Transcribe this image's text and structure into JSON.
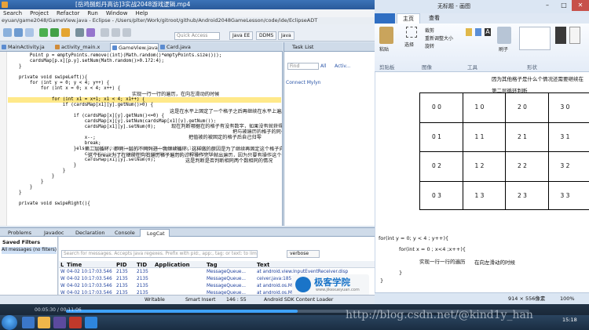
{
  "eclipse": {
    "window_title": "[岳鸡捌彪丹高访]3实战2048游戏逻辑.mp4",
    "path_title": "eyuan/game2048/GameView.java - Eclipse - /Users/plter/Work/gitroot/github/Android2048GameLesson/code/ide/EclipseADT",
    "menu": [
      "Search",
      "Project",
      "Refactor",
      "Run",
      "Window",
      "Help"
    ],
    "quick_access": "Quick Access",
    "perspectives": [
      "Java EE",
      "DDMS",
      "Java"
    ],
    "editor_tabs": [
      "MainActivity.ja",
      "activity_main.x",
      "GameView.java",
      "Card.java"
    ],
    "code_lines": [
      "        Point p = emptyPoints.remove((int)(Math.random()*emptyPoints.size()));",
      "        cardsMap[p.x][p.y].setNum(Math.random()>0.1?2:4);",
      "    }",
      "",
      "    private void swipeLeft(){",
      "        for (int y = 0; y < 4; y++) {",
      "            for (int x = 0; x < 4; x++) {",
      "",
      "                for (int x1 = x+1; x1 < 4; x1++) {",
      "                    if (cardsMap[x1][y].getNum()>0) {",
      "",
      "                        if (cardsMap[x][y].getNum()<=0) {",
      "                            cardsMap[x][y].setNum(cardsMap[x1][y].getNum());",
      "                            cardsMap[x1][y].setNum(0);",
      "",
      "                            x--;",
      "                            break;",
      "                        }else if (cardsMap[x][y].equals(cardsMap[x1][y])) {",
      "                            cardsMap[x][y].setNum(cardsMap[x][y].getNum()*2);",
      "                            cardsMap[x1][y].setNum(0);",
      "                        }",
      "                    }",
      "                }",
      "            }",
      "        }",
      "    }",
      "",
      "    private void swipeRight(){",
      ""
    ],
    "annotations": [
      "实现一行一行的遍历，在向左滑动的时候",
      "这是在水平上固定了一个格子之后再继续在水平上遍历别的格子，且当格子有数的时候进行以下的操作",
      "现在判断哪据在的格子有没有数字，如果没有就获得到数字赋到那里",
      "把与被遍历的格子的同一水平上的格子的数字赋给被固定的格子",
      "把值被的被固定的格子后自己归零",
      "第二层循环，即同一层的不同列进一我继续循环，这样做的原因是为了继续再固定这个格子向右检查与它同一水平上的别的格子的内容",
      "这个break为了在继续在向右遍历格子遍历的过程操作完毕就出遍历，因为只要有操作这个条件，就没有继续遍历下去的需要了",
      "这是判断是否判断相同两个数相同的情况"
    ],
    "task_list": {
      "tab": "Task List",
      "find": "Find",
      "all": "All",
      "activate": "Activ...",
      "mylyn": "Connect Mylyn"
    },
    "bottom_tabs": [
      "Problems",
      "Javadoc",
      "Declaration",
      "Console",
      "LogCat"
    ],
    "saved_filters": {
      "title": "Saved Filters",
      "all": "All messages (no filters)"
    },
    "logcat": {
      "search_placeholder": "Search for messages. Accepts Java regexes. Prefix with pid:, app:, tag: or text: to limit scope.",
      "level": "verbose",
      "headers": [
        "L",
        "Time",
        "PID",
        "TID",
        "Application",
        "Tag",
        "Text"
      ],
      "rows": [
        [
          "W",
          "04-02 10:17:03.546",
          "2135",
          "2135",
          "",
          "MessageQueue...",
          "at android.view.InputEventReceiver.disp"
        ],
        [
          "W",
          "04-02 10:17:03.546",
          "2135",
          "2135",
          "",
          "MessageQueue...",
          "ceiver.java:185)"
        ],
        [
          "W",
          "04-02 10:17:03.546",
          "2135",
          "2135",
          "",
          "MessageQueue...",
          "at android.os.MessageQueue.nativePollOnc"
        ],
        [
          "W",
          "04-02 10:17:03.546",
          "2135",
          "2135",
          "",
          "MessageQueue...",
          "at android.os.MessageQueue.next(Message"
        ]
      ]
    },
    "status": {
      "writable": "Writable",
      "insert": "Smart Insert",
      "pos": "146 : 55",
      "loader": "Android SDK Content Loader"
    },
    "logo": {
      "title": "极客学院",
      "url": "www.jikexueyuan.com"
    }
  },
  "paint": {
    "title": "无标题 - 画图",
    "tabs": [
      "",
      "主页",
      "查看"
    ],
    "ribbon": {
      "paste": "粘贴",
      "clipboard": "剪贴板",
      "image": "图像",
      "tools": "工具",
      "shapes": "形状",
      "brush": "刷子",
      "crop": "裁剪",
      "resize": "重新调整大小",
      "rotate": "旋转",
      "select": "选择"
    },
    "canvas_texts": [
      "因为其他格子是什么个情况还需要继续在",
      "第二层循环判断",
      "for(int y = 0; y < 4 ; y++){",
      "for(int x = 0 ; x<4 ;x++){",
      "实现一行一行的遍历",
      "在向左滑动的时候",
      "}",
      "}"
    ],
    "grid_cells": [
      [
        "0 0",
        "1 0",
        "2 0",
        "3 0"
      ],
      [
        "0 1",
        "1 1",
        "2 1",
        "3 1"
      ],
      [
        "0 2",
        "1 2",
        "2 2",
        "3 2"
      ],
      [
        "0 3",
        "1 3",
        "2 3",
        "3 3"
      ]
    ],
    "size": "914 × 556像素",
    "zoom": "100%"
  },
  "taskbar": {
    "video_time": "00:05:30 / 00:11:06",
    "clock": "15:18",
    "watermark": "http://blog.csdn.net/@kind1y_han"
  },
  "colors": {
    "accent": "#2f6ec2",
    "progress": "#3fa2ff"
  },
  "progress_fraction": 0.5
}
